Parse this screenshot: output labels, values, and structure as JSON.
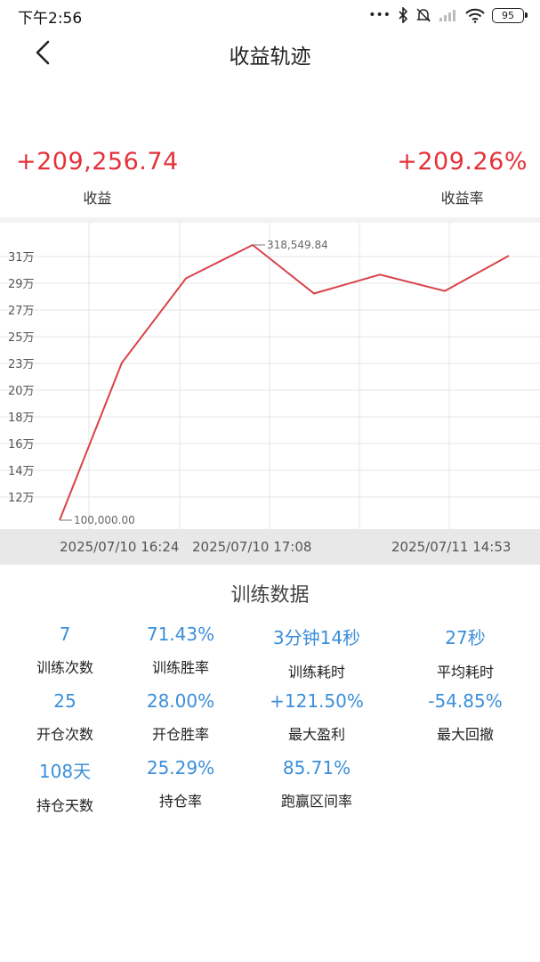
{
  "status_bar": {
    "time": "下午2:56",
    "battery": "95"
  },
  "header": {
    "title": "收益轨迹"
  },
  "summary": {
    "profit_value": "+209,256.74",
    "profit_label": "收益",
    "rate_value": "+209.26%",
    "rate_label": "收益率"
  },
  "chart_data": {
    "type": "line",
    "y_ticks": [
      "12万",
      "14万",
      "16万",
      "18万",
      "20万",
      "23万",
      "25万",
      "27万",
      "29万",
      "31万"
    ],
    "series": [
      {
        "values": [
          100000,
          225000,
          292000,
          318549.84,
          280000,
          295000,
          282000,
          310000
        ]
      }
    ],
    "annotations": {
      "min_label": "100,000.00",
      "max_label": "318,549.84"
    },
    "x_labels": [
      "2025/07/10 16:24",
      "2025/07/10 17:08",
      "2025/07/11 14:53"
    ],
    "line_color": "#d9424a"
  },
  "training": {
    "title": "训练数据",
    "stats": [
      {
        "value": "7",
        "label": "训练次数"
      },
      {
        "value": "71.43%",
        "label": "训练胜率"
      },
      {
        "value": "3分钟14秒",
        "label": "训练耗时"
      },
      {
        "value": "27秒",
        "label": "平均耗时"
      },
      {
        "value": "25",
        "label": "开仓次数"
      },
      {
        "value": "28.00%",
        "label": "开仓胜率"
      },
      {
        "value": "+121.50%",
        "label": "最大盈利"
      },
      {
        "value": "-54.85%",
        "label": "最大回撤"
      },
      {
        "value": "108天",
        "label": "持仓天数"
      },
      {
        "value": "25.29%",
        "label": "持仓率"
      },
      {
        "value": "85.71%",
        "label": "跑赢区间率"
      }
    ]
  },
  "colors": {
    "accent_red": "#e3323a",
    "accent_blue": "#3b8fd9"
  }
}
